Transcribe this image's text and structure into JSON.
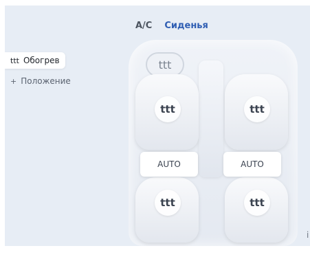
{
  "tabs": {
    "ac_label": "A/C",
    "seats_label": "Сиденья"
  },
  "side_menu": {
    "heating": {
      "icon": "ttt",
      "label": "Обогрев"
    },
    "position": {
      "icon": "+",
      "label": "Положение"
    }
  },
  "seats": {
    "heat_icon": "ttt",
    "auto_left_label": "AUTO",
    "auto_right_label": "AUTO",
    "wheel_icon": "ttt"
  },
  "info_icon": "i",
  "colors": {
    "panel": "#e7edf5",
    "active_tab": "#2f5eb3"
  }
}
